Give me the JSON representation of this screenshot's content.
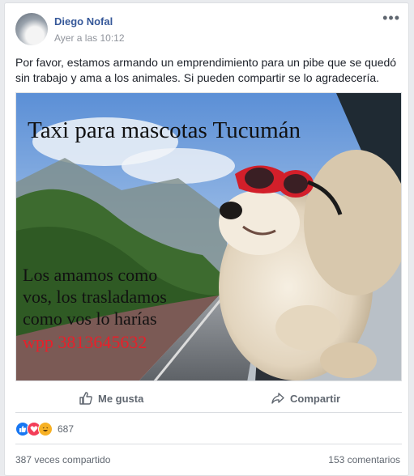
{
  "post": {
    "author": "Diego Nofal",
    "time": "Ayer a las 10:12",
    "more_label": "•••",
    "text": "Por favor, estamos armando un emprendimiento para un pibe que se quedó sin trabajo y ama a los animales. Si pueden compartir se lo agradecería."
  },
  "image": {
    "title": "Taxi para mascotas Tucumán",
    "line1": "Los amamos como",
    "line2": "vos, los trasladamos",
    "line3": "como vos lo harías",
    "phone": "wpp 3813645632"
  },
  "actions": {
    "like_label": "Me gusta",
    "share_label": "Compartir"
  },
  "reactions": {
    "count": "687",
    "types": [
      "like-icon",
      "love-icon",
      "haha-icon"
    ]
  },
  "footer": {
    "shares": "387 veces compartido",
    "comments": "153 comentarios"
  },
  "colors": {
    "link": "#365899",
    "like": "#1877f2",
    "love": "#f33e58",
    "haha": "#f7b125",
    "phone_text": "#e8202a"
  }
}
